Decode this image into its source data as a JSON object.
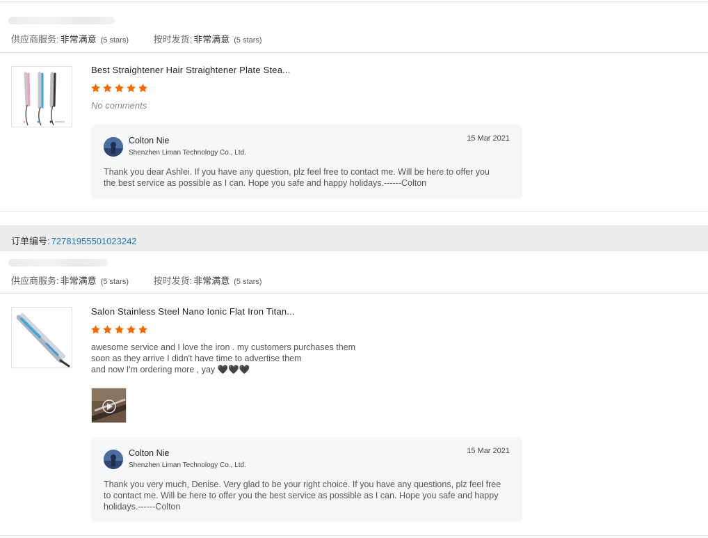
{
  "reviews": [
    {
      "ratings": [
        {
          "label": "供应商服务:",
          "value": "非常满意",
          "stars": "(5 stars)"
        },
        {
          "label": "按时发货:",
          "value": "非常满意",
          "stars": "(5 stars)"
        }
      ],
      "product_title": "Best Straightener Hair Straightener Plate Stea...",
      "star_rating": 5,
      "comment": "No comments",
      "reply": {
        "name": "Colton Nie",
        "company": "Shenzhen Liman Technology Co., Ltd.",
        "date": "15 Mar 2021",
        "text": "Thank you dear Ashlei. If you have any question, plz feel free to contact me. Will be here to offer you the best service as possible as I can. Hope you safe and happy holidays.------Colton"
      }
    },
    {
      "order_label": "订单编号:",
      "order_number": "72781955501023242",
      "ratings": [
        {
          "label": "供应商服务:",
          "value": "非常满意",
          "stars": "(5 stars)"
        },
        {
          "label": "按时发货:",
          "value": "非常满意",
          "stars": "(5 stars)"
        }
      ],
      "product_title": "Salon Stainless Steel Nano Ionic Flat Iron Titan...",
      "star_rating": 5,
      "comment_lines": [
        "awesome service and I love the iron . my customers purchases them",
        "soon as they arrive I didn't have time to advertise them",
        "and now I'm ordering more , yay 🖤🖤🖤"
      ],
      "reply": {
        "name": "Colton Nie",
        "company": "Shenzhen Liman Technology Co., Ltd.",
        "date": "15 Mar 2021",
        "text": "Thank you very much, Denise. Very glad to be your right choice. If you have any questions, plz feel free to contact me. Will be here to offer you the best service as possible as I can. Hope you safe and happy holidays.------Colton"
      }
    }
  ],
  "colors": {
    "star": "#f56a00",
    "link": "#1e73be",
    "reply_bg": "#f6f7f9"
  }
}
